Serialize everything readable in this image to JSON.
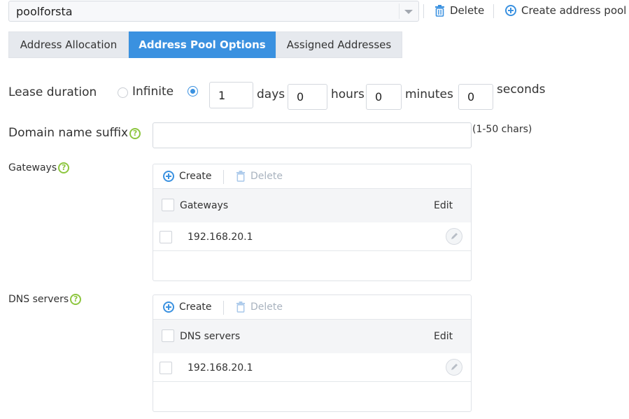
{
  "toolbar": {
    "pool_value": "poolforsta",
    "delete_label": "Delete",
    "create_label": "Create address pool"
  },
  "tabs": [
    {
      "label": "Address Allocation",
      "active": false
    },
    {
      "label": "Address Pool Options",
      "active": true
    },
    {
      "label": "Assigned Addresses",
      "active": false
    }
  ],
  "lease": {
    "label": "Lease duration",
    "infinite_label": "Infinite",
    "selected": "custom",
    "days": "1",
    "days_label": "days",
    "hours": "0",
    "hours_label": "hours",
    "minutes": "0",
    "minutes_label": "minutes",
    "seconds": "0",
    "seconds_label": "seconds"
  },
  "domain": {
    "label": "Domain name suffix",
    "value": "",
    "hint": "(1-50 chars)"
  },
  "gateways": {
    "label": "Gateways",
    "create_label": "Create",
    "delete_label": "Delete",
    "column": "Gateways",
    "edit_label": "Edit",
    "rows": [
      "192.168.20.1"
    ]
  },
  "dns": {
    "label": "DNS servers",
    "create_label": "Create",
    "delete_label": "Delete",
    "column": "DNS servers",
    "edit_label": "Edit",
    "rows": [
      "192.168.20.1"
    ]
  },
  "colors": {
    "accent": "#3a91e0",
    "help": "#8dc63f",
    "tab_inactive": "#e6e9ee"
  },
  "icons": [
    "chevron-down-icon",
    "trash-icon",
    "plus-circle-icon",
    "help-icon",
    "pencil-icon"
  ]
}
